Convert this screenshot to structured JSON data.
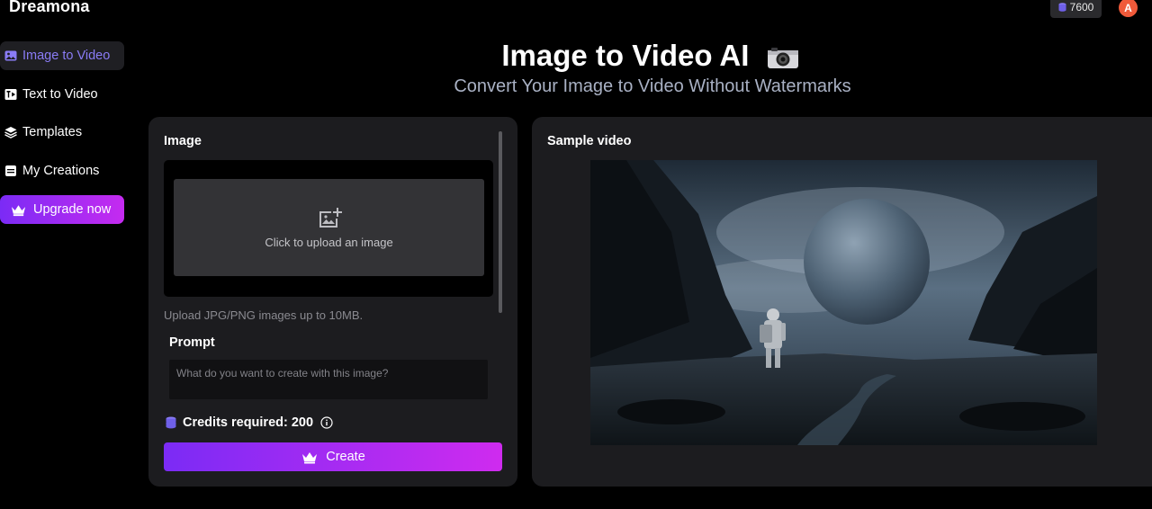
{
  "app": {
    "name": "Dreamona"
  },
  "header": {
    "credits": "7600",
    "avatar_initial": "A"
  },
  "sidebar": {
    "items": [
      {
        "label": "Image to Video",
        "icon": "image-icon",
        "active": true
      },
      {
        "label": "Text to Video",
        "icon": "text-video-icon",
        "active": false
      },
      {
        "label": "Templates",
        "icon": "layers-icon",
        "active": false
      },
      {
        "label": "My Creations",
        "icon": "archive-icon",
        "active": false
      }
    ],
    "upgrade_label": "Upgrade now"
  },
  "hero": {
    "title": "Image to Video AI",
    "title_icon": "camera-icon",
    "subtitle": "Convert Your Image to Video Without Watermarks"
  },
  "form": {
    "image_label": "Image",
    "upload_text": "Click to upload an image",
    "upload_hint": "Upload JPG/PNG images up to 10MB.",
    "prompt_label": "Prompt",
    "prompt_value": "",
    "prompt_placeholder": "What do you want to create with this image?",
    "credits_required": "Credits required: 200",
    "create_label": "Create"
  },
  "sample": {
    "label": "Sample video"
  },
  "colors": {
    "accent_start": "#7b2bf5",
    "accent_end": "#cf2bef",
    "active_text": "#8a7cf6",
    "avatar_bg": "#f05a3a"
  }
}
